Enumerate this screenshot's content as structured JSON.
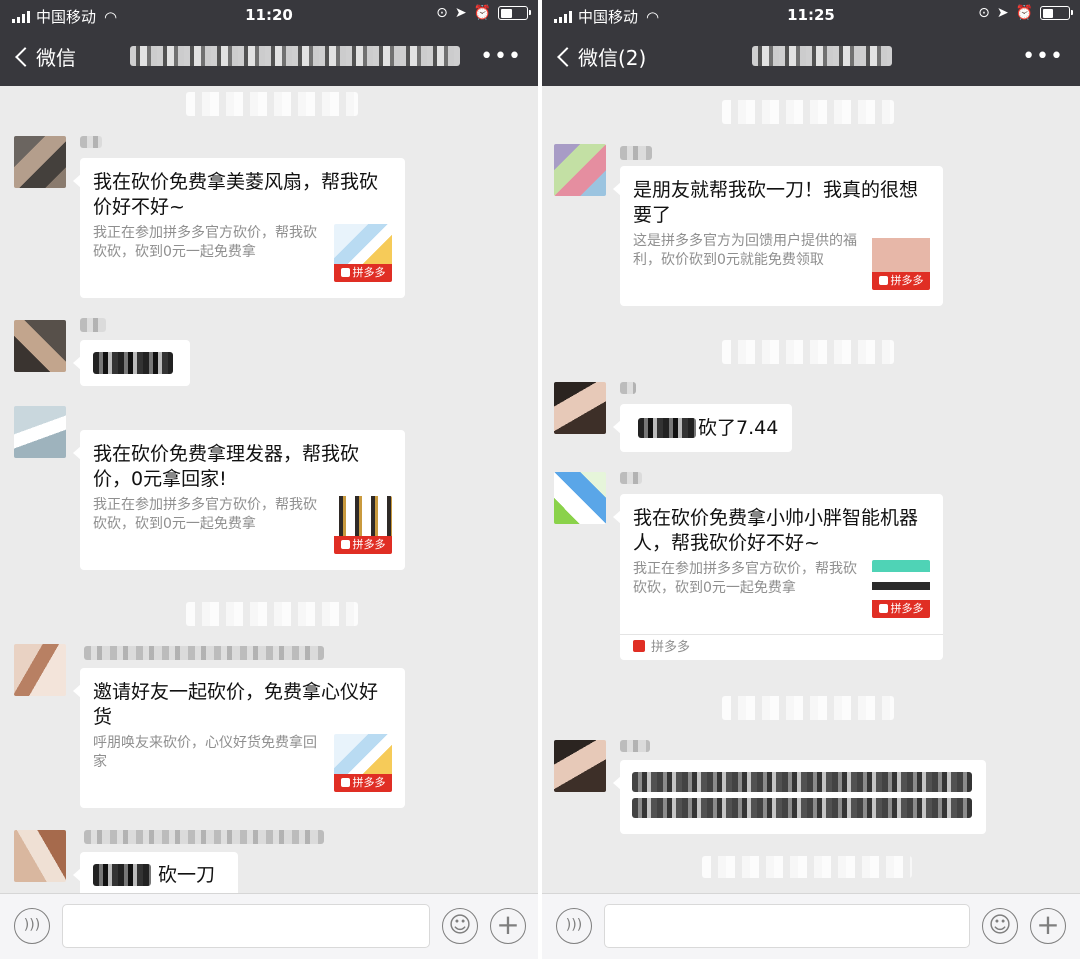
{
  "colors": {
    "nav_bg": "#38383d",
    "chat_bg": "#ebebeb",
    "pdd_red": "#e02e24",
    "desc_gray": "#8f8f8f"
  },
  "left": {
    "status": {
      "carrier": "中国移动",
      "time": "11:20"
    },
    "nav": {
      "back_label": "微信"
    },
    "messages": [
      {
        "title": "我在砍价免费拿美菱风扇，帮我砍价好不好~",
        "desc": "我正在参加拼多多官方砍价，帮我砍砍砍，砍到0元一起免费拿",
        "badge": "拼多多"
      },
      {
        "title": "我在砍价免费拿理发器，帮我砍价，0元拿回家!",
        "desc": "我正在参加拼多多官方砍价，帮我砍砍砍，砍到0元一起免费拿",
        "badge": "拼多多"
      },
      {
        "title": "邀请好友一起砍价，免费拿心仪好货",
        "desc": "呼朋唤友来砍价，心仪好货免费拿回家",
        "badge": "拼多多"
      },
      {
        "text": "砍一刀"
      }
    ]
  },
  "right": {
    "status": {
      "carrier": "中国移动",
      "time": "11:25"
    },
    "nav": {
      "back_label": "微信(2)"
    },
    "messages": [
      {
        "title": "是朋友就帮我砍一刀！我真的很想要了",
        "desc": "这是拼多多官方为回馈用户提供的福利，砍价砍到0元就能免费领取",
        "badge": "拼多多"
      },
      {
        "text": "砍了7.44"
      },
      {
        "title": "我在砍价免费拿小帅小胖智能机器人，帮我砍价好不好~",
        "desc": "我正在参加拼多多官方砍价，帮我砍砍砍，砍到0元一起免费拿",
        "badge": "拼多多",
        "source": "拼多多"
      }
    ]
  },
  "icons": {
    "back": "chevron-left-icon",
    "more": "more-dots-icon",
    "voice": "voice-icon",
    "emoji": "emoji-icon",
    "plus": "plus-icon"
  }
}
